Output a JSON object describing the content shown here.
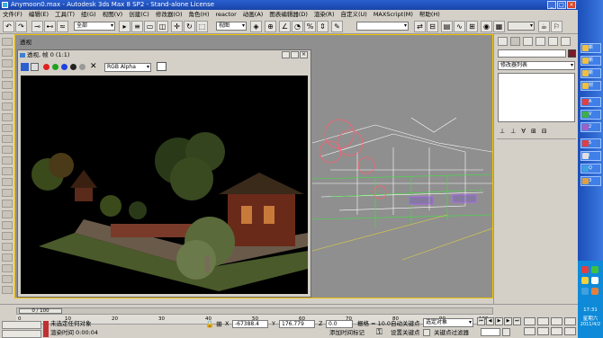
{
  "window": {
    "title": "Anymoon0.max - Autodesk 3ds Max 8 SP2 - Stand-alone License"
  },
  "menu": [
    "文件(F)",
    "编辑(E)",
    "工具(T)",
    "组(G)",
    "视图(V)",
    "创建(C)",
    "修改器(O)",
    "角色(H)",
    "reactor",
    "动画(A)",
    "图表编辑器(D)",
    "渲染(R)",
    "自定义(U)",
    "MAXScript(M)",
    "帮助(H)"
  ],
  "toolbar": {
    "selection_filter": "全部",
    "ref_coord": "视图"
  },
  "viewport": {
    "label": "透视"
  },
  "render_window": {
    "title": "透视, 帧 0 (1:1)",
    "channel": "RGB Alpha"
  },
  "command_panel": {
    "modifier_list": "修改器列表"
  },
  "timeline": {
    "frame": "0 / 100",
    "ticks": [
      "0",
      "10",
      "20",
      "30",
      "40",
      "50",
      "60",
      "70",
      "80",
      "90",
      "100"
    ]
  },
  "status": {
    "selection": "未选定任何对象",
    "render_time_label": "渲染时间",
    "render_time": "0:00:04",
    "x_label": "X",
    "x_value": "-67388.4",
    "y_label": "Y",
    "y_value": "176.779",
    "z_label": "Z",
    "z_value": "0.0",
    "grid": "栅格 = 10.0",
    "autokey": "自动关键点",
    "set_key": "设置关键点",
    "selected_object": "选定对象",
    "key_filters": "关键点过滤器",
    "add_time_tag": "添加时间标记"
  },
  "taskbar": {
    "time": "17:31",
    "weekday": "星期六",
    "date": "2011/4/2"
  }
}
